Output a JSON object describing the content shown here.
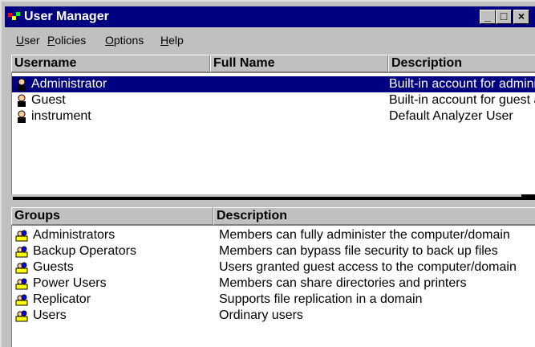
{
  "window": {
    "title": "User Manager",
    "controls": {
      "minimize": "_",
      "maximize": "□",
      "close": "×"
    }
  },
  "menu": [
    {
      "label": "User",
      "accel": "U"
    },
    {
      "label": "Policies",
      "accel": "P"
    },
    {
      "label": "Options",
      "accel": "O"
    },
    {
      "label": "Help",
      "accel": "H"
    }
  ],
  "users": {
    "headers": {
      "username": "Username",
      "fullname": "Full Name",
      "description": "Description"
    },
    "rows": [
      {
        "username": "Administrator",
        "fullname": "",
        "description": "Built-in account for administering the computer/domain",
        "selected": true,
        "icon": "user-icon"
      },
      {
        "username": "Guest",
        "fullname": "",
        "description": "Built-in account for guest access to the computer/domain",
        "selected": false,
        "icon": "user-icon"
      },
      {
        "username": "instrument",
        "fullname": "",
        "description": "Default Analyzer User",
        "selected": false,
        "icon": "user-icon"
      }
    ]
  },
  "groups": {
    "headers": {
      "group": "Groups",
      "description": "Description"
    },
    "rows": [
      {
        "name": "Administrators",
        "description": "Members can fully administer the computer/domain",
        "icon": "group-icon"
      },
      {
        "name": "Backup Operators",
        "description": "Members can bypass file security to back up files",
        "icon": "group-icon"
      },
      {
        "name": "Guests",
        "description": "Users granted guest access to the computer/domain",
        "icon": "group-icon"
      },
      {
        "name": "Power Users",
        "description": "Members can share directories and printers",
        "icon": "group-icon"
      },
      {
        "name": "Replicator",
        "description": "Supports file replication in a domain",
        "icon": "group-icon"
      },
      {
        "name": "Users",
        "description": "Ordinary users",
        "icon": "group-icon"
      }
    ]
  },
  "colors": {
    "titlebar": "#000080",
    "selection": "#000080",
    "face": "#c0c0c0"
  }
}
